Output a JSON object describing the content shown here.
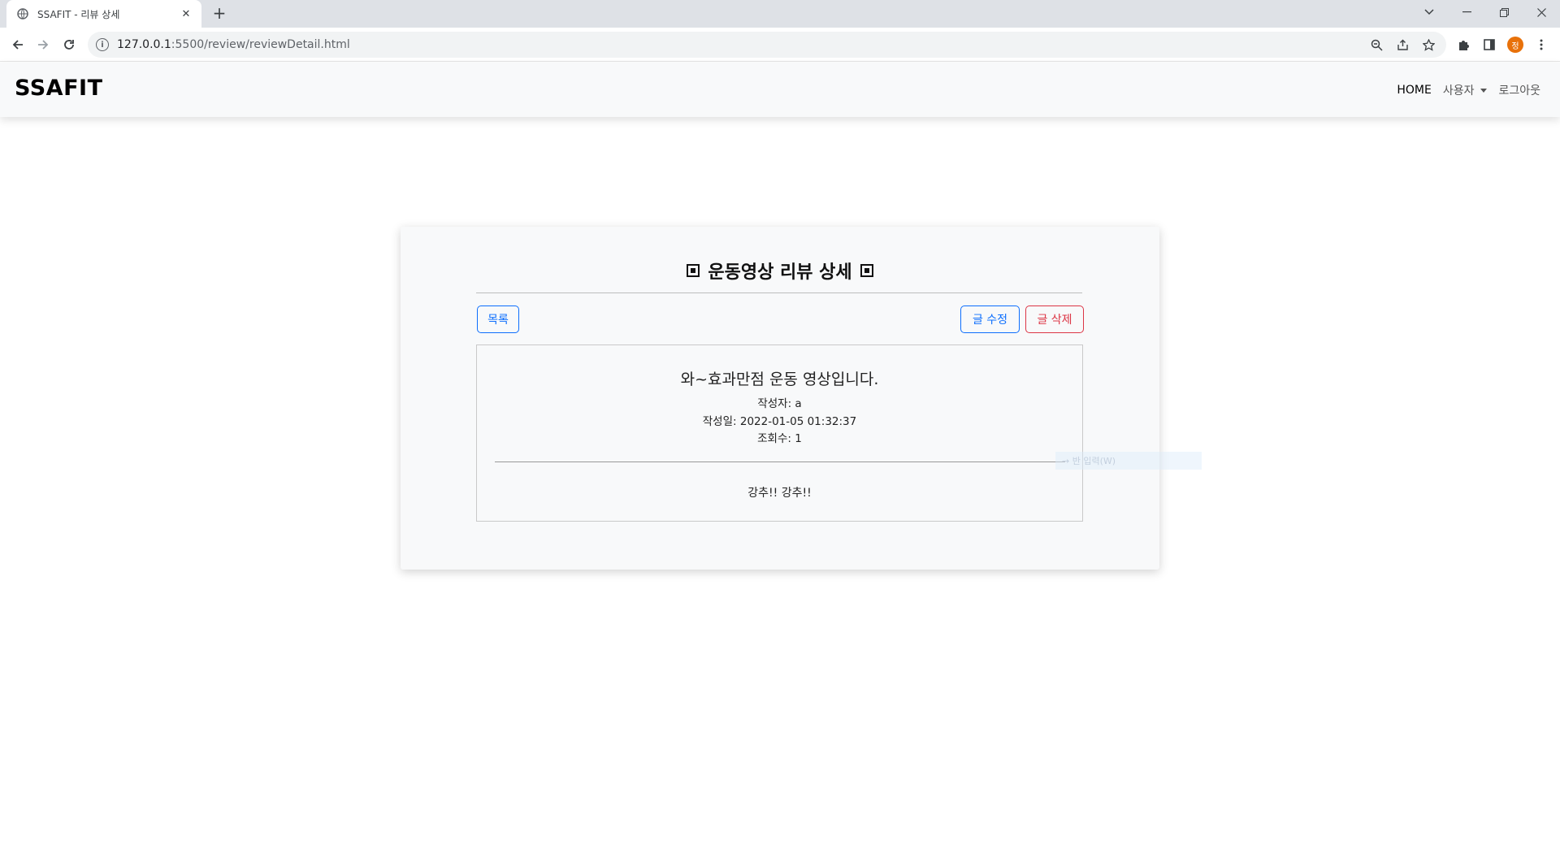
{
  "browser": {
    "tab_title": "SSAFIT - 리뷰 상세",
    "url_host": "127.0.0.1",
    "url_path": ":5500/review/reviewDetail.html",
    "profile_initial": "정"
  },
  "navbar": {
    "brand": "SSAFIT",
    "home": "HOME",
    "user": "사용자",
    "logout": "로그아웃"
  },
  "review": {
    "page_title": "운동영상 리뷰 상세",
    "list_button": "목록",
    "edit_button": "글 수정",
    "delete_button": "글 삭제",
    "title": "와~효과만점 운동 영상입니다.",
    "author": "작성자: a",
    "date": "작성일: 2022-01-05 01:32:37",
    "views": "조회수: 1",
    "content": "강추!! 강추!!"
  },
  "ghost_tooltip": "→ 반 입력(W)",
  "colors": {
    "primary": "#0d6efd",
    "danger": "#dc3545",
    "navbar_bg": "#f8f9fa"
  }
}
